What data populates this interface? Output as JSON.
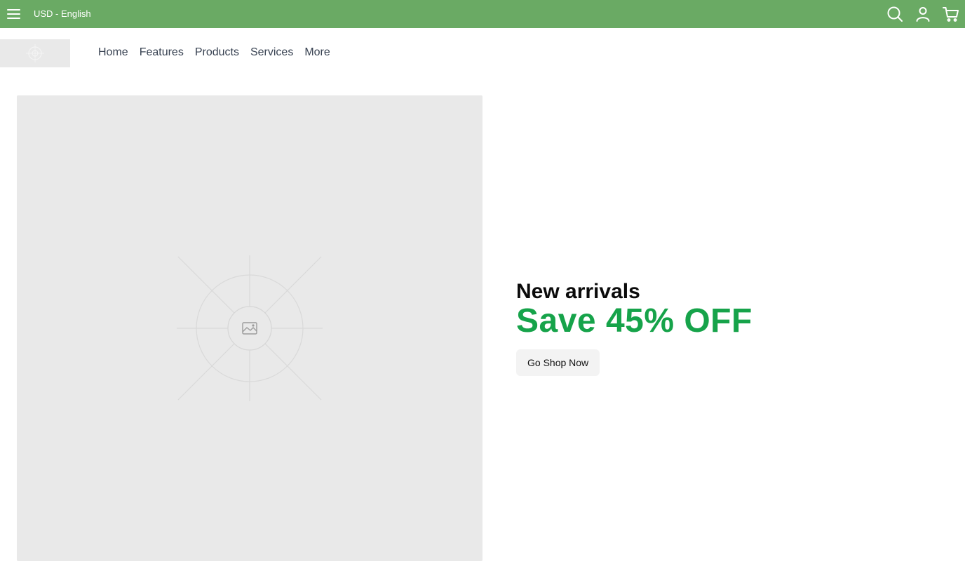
{
  "topbar": {
    "locale": "USD - English",
    "background": "#6aaa64",
    "icons": [
      "menu-icon",
      "search-icon",
      "user-icon",
      "cart-icon"
    ]
  },
  "nav": {
    "links": [
      "Home",
      "Features",
      "Products",
      "Services",
      "More"
    ]
  },
  "hero": {
    "kicker": "New arrivals",
    "headline": "Save 45% OFF",
    "cta": "Go Shop Now",
    "accent": "#16a34a",
    "image_icon": "image-placeholder-icon"
  }
}
